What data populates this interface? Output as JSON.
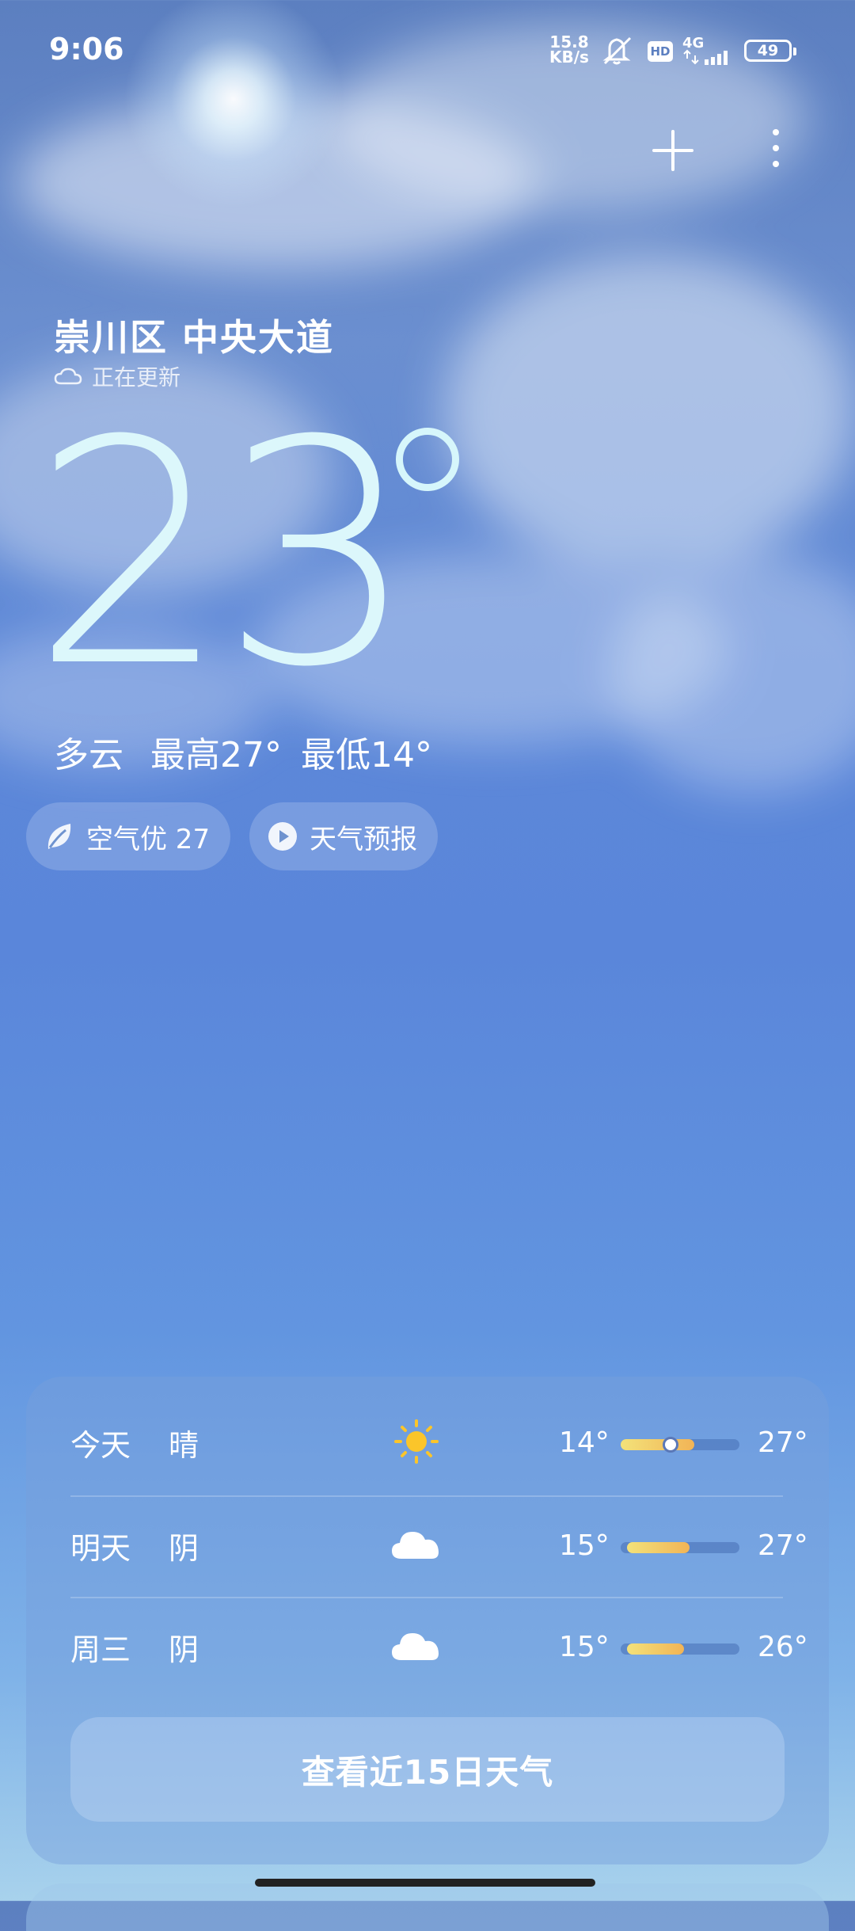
{
  "status_bar": {
    "time": "9:06",
    "net_speed_value": "15.8",
    "net_speed_unit": "KB/s",
    "hd": "HD",
    "network_type": "4G",
    "battery": "49"
  },
  "header": {
    "location": "崇川区 中央大道",
    "update_status": "正在更新"
  },
  "current": {
    "temperature": "23",
    "condition": "多云",
    "high": "最高27°",
    "low": "最低14°"
  },
  "chips": {
    "air_quality": "空气优 27",
    "forecast_video": "天气预报"
  },
  "forecast": [
    {
      "day": "今天",
      "condition": "晴",
      "icon": "sun-icon",
      "low": "14°",
      "high": "27°",
      "bar_start": 0.0,
      "bar_end": 0.62,
      "current_marker": 0.4
    },
    {
      "day": "明天",
      "condition": "阴",
      "icon": "cloud-icon",
      "low": "15°",
      "high": "27°",
      "bar_start": 0.05,
      "bar_end": 0.58
    },
    {
      "day": "周三",
      "condition": "阴",
      "icon": "cloud-icon",
      "low": "15°",
      "high": "26°",
      "bar_start": 0.05,
      "bar_end": 0.53
    }
  ],
  "forecast_button": "查看近15日天气",
  "colors": {
    "temperature_text": "#d6f6fb",
    "bar_gradient_start": "#f3e27a",
    "bar_gradient_end": "#f2b456"
  }
}
